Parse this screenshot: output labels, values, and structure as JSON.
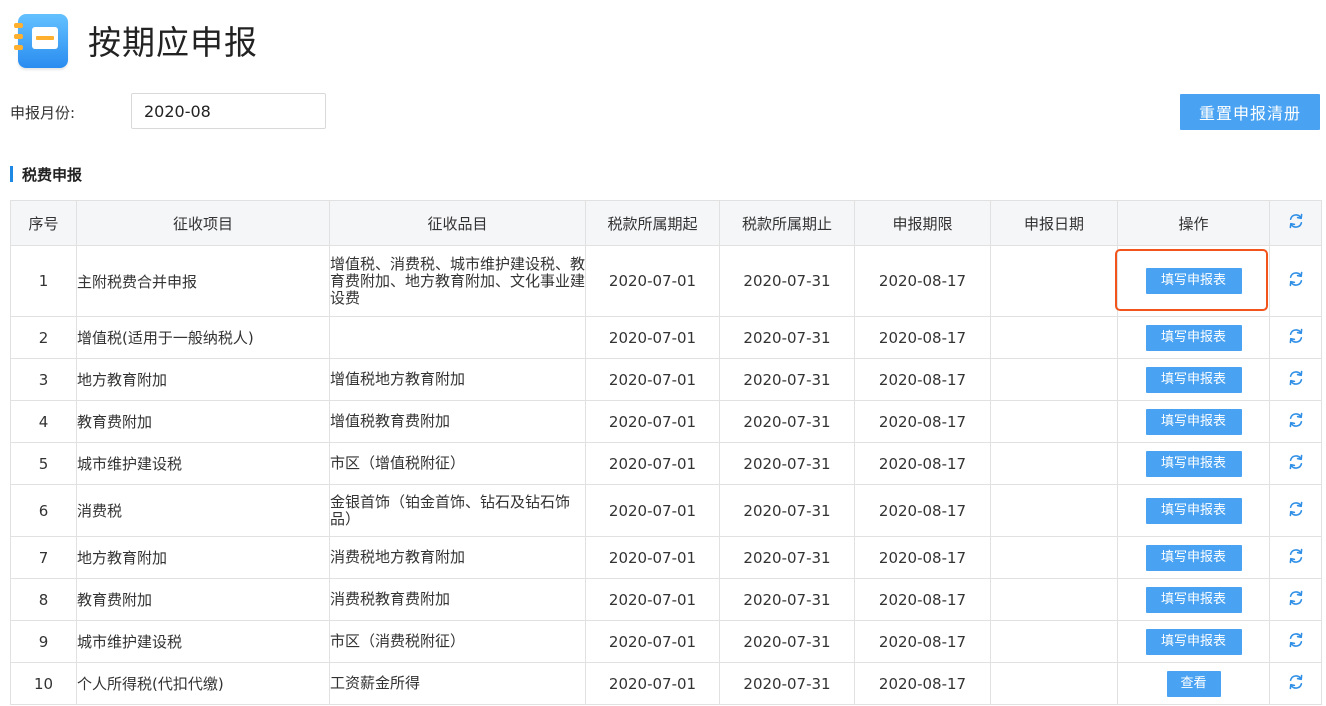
{
  "header": {
    "title": "按期应申报"
  },
  "filter": {
    "month_label": "申报月份:",
    "month_value": "2020-08"
  },
  "actions": {
    "reset_label": "重置申报清册"
  },
  "section": {
    "title": "税费申报"
  },
  "colors": {
    "primary": "#4aa3f2",
    "highlight": "#f2541b",
    "header_bg": "#f5f6f8",
    "section_bar": "#1e88e5"
  },
  "table": {
    "headers": [
      "序号",
      "征收项目",
      "征收品目",
      "税款所属期起",
      "税款所属期止",
      "申报期限",
      "申报日期",
      "操作"
    ],
    "header_icon": "refresh-icon",
    "rows": [
      {
        "no": "1",
        "project": "主附税费合并申报",
        "item": "增值税、消费税、城市维护建设税、教育费附加、地方教育附加、文化事业建设费",
        "start": "2020-07-01",
        "end": "2020-07-31",
        "deadline": "2020-08-17",
        "date": "",
        "action": "填写申报表"
      },
      {
        "no": "2",
        "project": "增值税(适用于一般纳税人)",
        "item": "",
        "start": "2020-07-01",
        "end": "2020-07-31",
        "deadline": "2020-08-17",
        "date": "",
        "action": "填写申报表"
      },
      {
        "no": "3",
        "project": "地方教育附加",
        "item": "增值税地方教育附加",
        "start": "2020-07-01",
        "end": "2020-07-31",
        "deadline": "2020-08-17",
        "date": "",
        "action": "填写申报表"
      },
      {
        "no": "4",
        "project": "教育费附加",
        "item": "增值税教育费附加",
        "start": "2020-07-01",
        "end": "2020-07-31",
        "deadline": "2020-08-17",
        "date": "",
        "action": "填写申报表"
      },
      {
        "no": "5",
        "project": "城市维护建设税",
        "item": "市区（增值税附征）",
        "start": "2020-07-01",
        "end": "2020-07-31",
        "deadline": "2020-08-17",
        "date": "",
        "action": "填写申报表"
      },
      {
        "no": "6",
        "project": "消费税",
        "item": "金银首饰（铂金首饰、钻石及钻石饰品）",
        "start": "2020-07-01",
        "end": "2020-07-31",
        "deadline": "2020-08-17",
        "date": "",
        "action": "填写申报表"
      },
      {
        "no": "7",
        "project": "地方教育附加",
        "item": "消费税地方教育附加",
        "start": "2020-07-01",
        "end": "2020-07-31",
        "deadline": "2020-08-17",
        "date": "",
        "action": "填写申报表"
      },
      {
        "no": "8",
        "project": "教育费附加",
        "item": "消费税教育费附加",
        "start": "2020-07-01",
        "end": "2020-07-31",
        "deadline": "2020-08-17",
        "date": "",
        "action": "填写申报表"
      },
      {
        "no": "9",
        "project": "城市维护建设税",
        "item": "市区（消费税附征）",
        "start": "2020-07-01",
        "end": "2020-07-31",
        "deadline": "2020-08-17",
        "date": "",
        "action": "填写申报表"
      },
      {
        "no": "10",
        "project": "个人所得税(代扣代缴)",
        "item": "工资薪金所得",
        "start": "2020-07-01",
        "end": "2020-07-31",
        "deadline": "2020-08-17",
        "date": "",
        "action": "查看"
      }
    ]
  }
}
